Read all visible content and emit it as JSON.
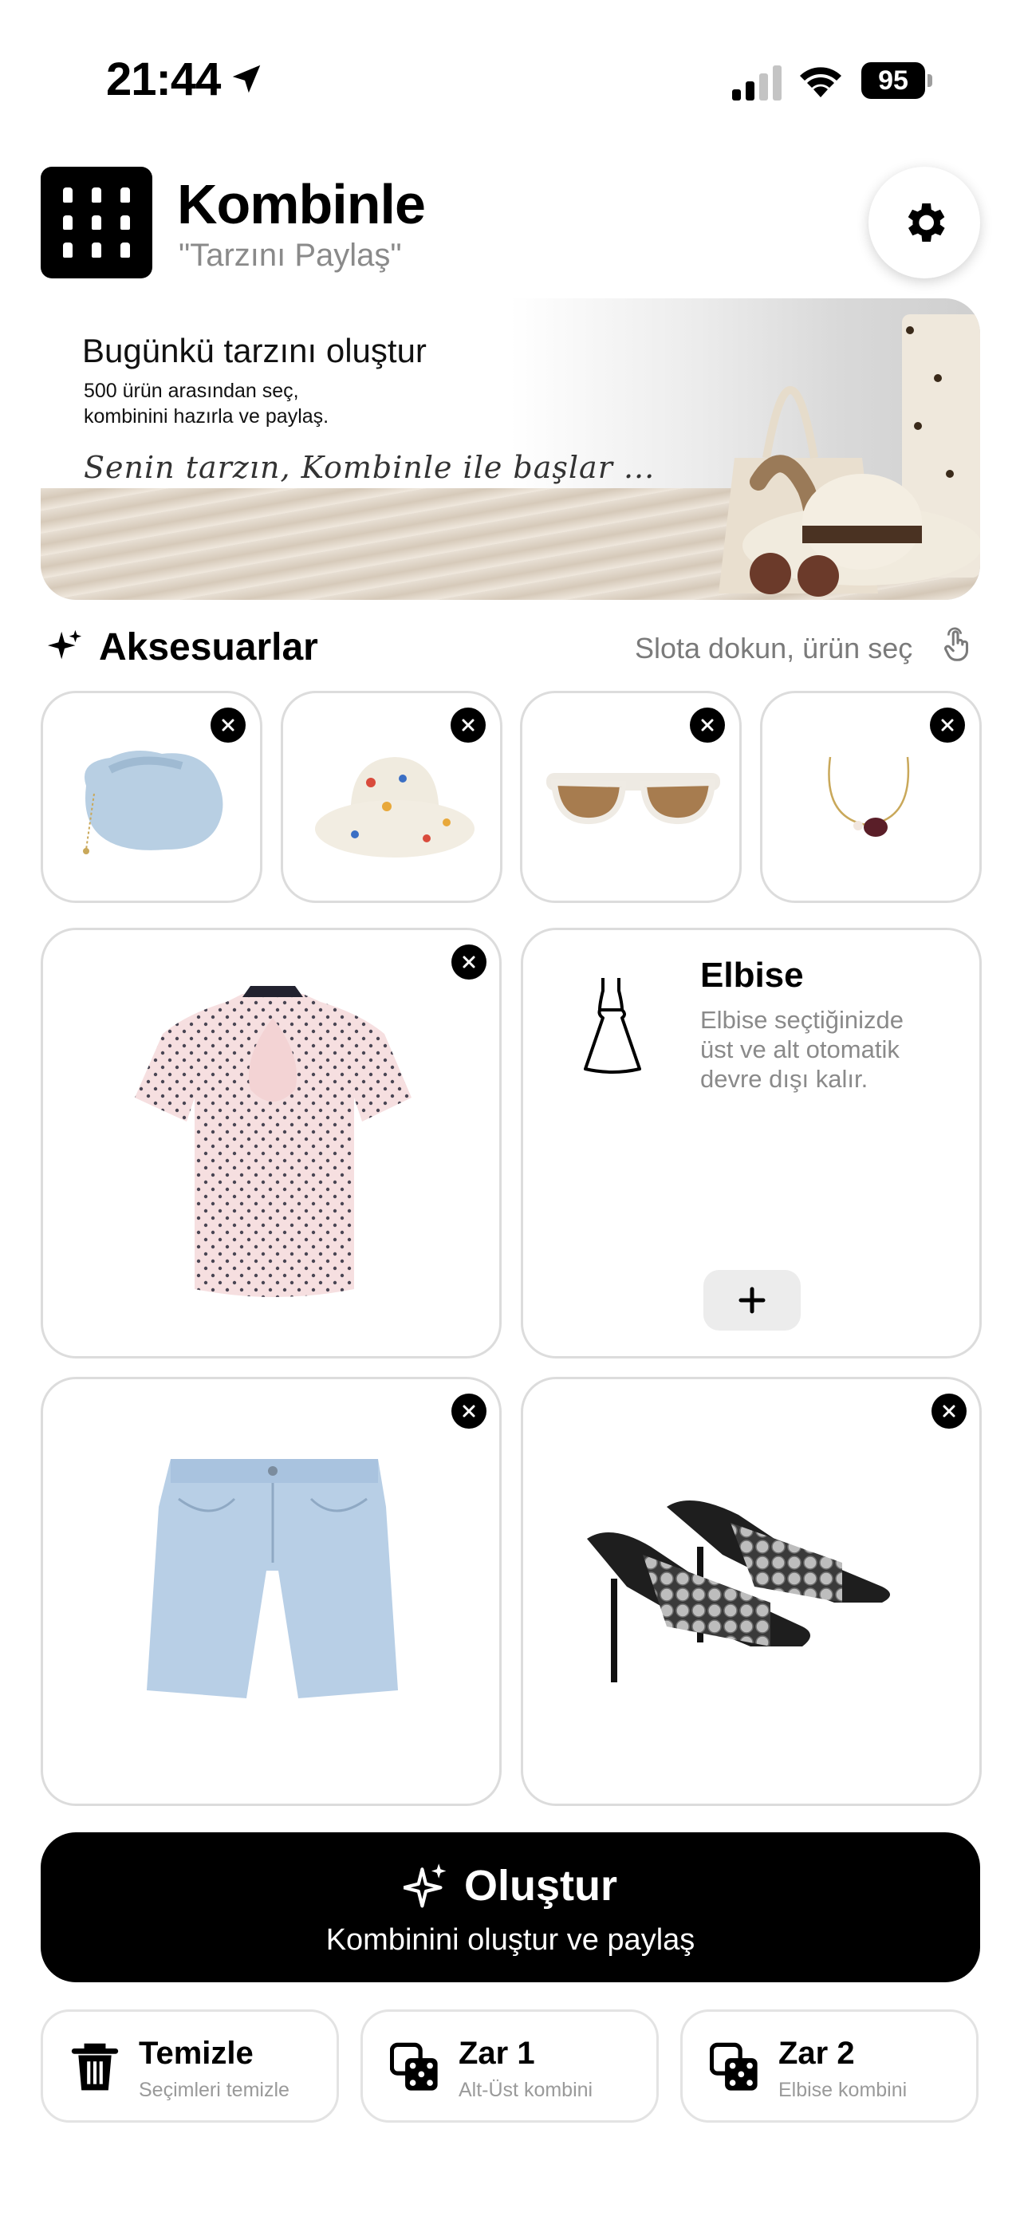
{
  "status_bar": {
    "time": "21:44",
    "battery": "95",
    "icons": [
      "location-arrow-icon",
      "signal-icon",
      "wifi-icon",
      "battery-icon"
    ]
  },
  "header": {
    "title": "Kombinle",
    "subtitle": "\"Tarzını Paylaş\"",
    "settings_icon": "gear-icon"
  },
  "banner": {
    "title": "Bugünkü tarzını oluştur",
    "subtitle_line1": "500 ürün arasından seç,",
    "subtitle_line2": "kombinini hazırla ve paylaş.",
    "tagline": "Senin tarzın, Kombinle ile başlar ..."
  },
  "accessories": {
    "title": "Aksesuarlar",
    "hint": "Slota dokun, ürün seç",
    "items": [
      {
        "name": "bag",
        "icon": "handbag-image"
      },
      {
        "name": "hat",
        "icon": "bucket-hat-image"
      },
      {
        "name": "sunglasses",
        "icon": "sunglasses-image"
      },
      {
        "name": "necklace",
        "icon": "necklace-image"
      }
    ]
  },
  "outfit": {
    "top": {
      "icon": "polka-dot-blouse-image"
    },
    "dress": {
      "title": "Elbise",
      "description": "Elbise seçtiğinizde üst ve alt otomatik devre dışı kalır.",
      "add_label": "+"
    },
    "bottom": {
      "icon": "denim-shorts-image"
    },
    "shoes": {
      "icon": "sequin-heels-image"
    }
  },
  "create_button": {
    "title": "Oluştur",
    "subtitle": "Kombinini oluştur ve paylaş"
  },
  "actions": [
    {
      "title": "Temizle",
      "subtitle": "Seçimleri temizle",
      "icon": "trash-icon"
    },
    {
      "title": "Zar 1",
      "subtitle": "Alt-Üst kombini",
      "icon": "dice-icon"
    },
    {
      "title": "Zar 2",
      "subtitle": "Elbise kombini",
      "icon": "dice-icon"
    }
  ],
  "colors": {
    "accent": "#000000",
    "muted_text": "#8a8a8a",
    "card_border": "#dcdcdc"
  }
}
